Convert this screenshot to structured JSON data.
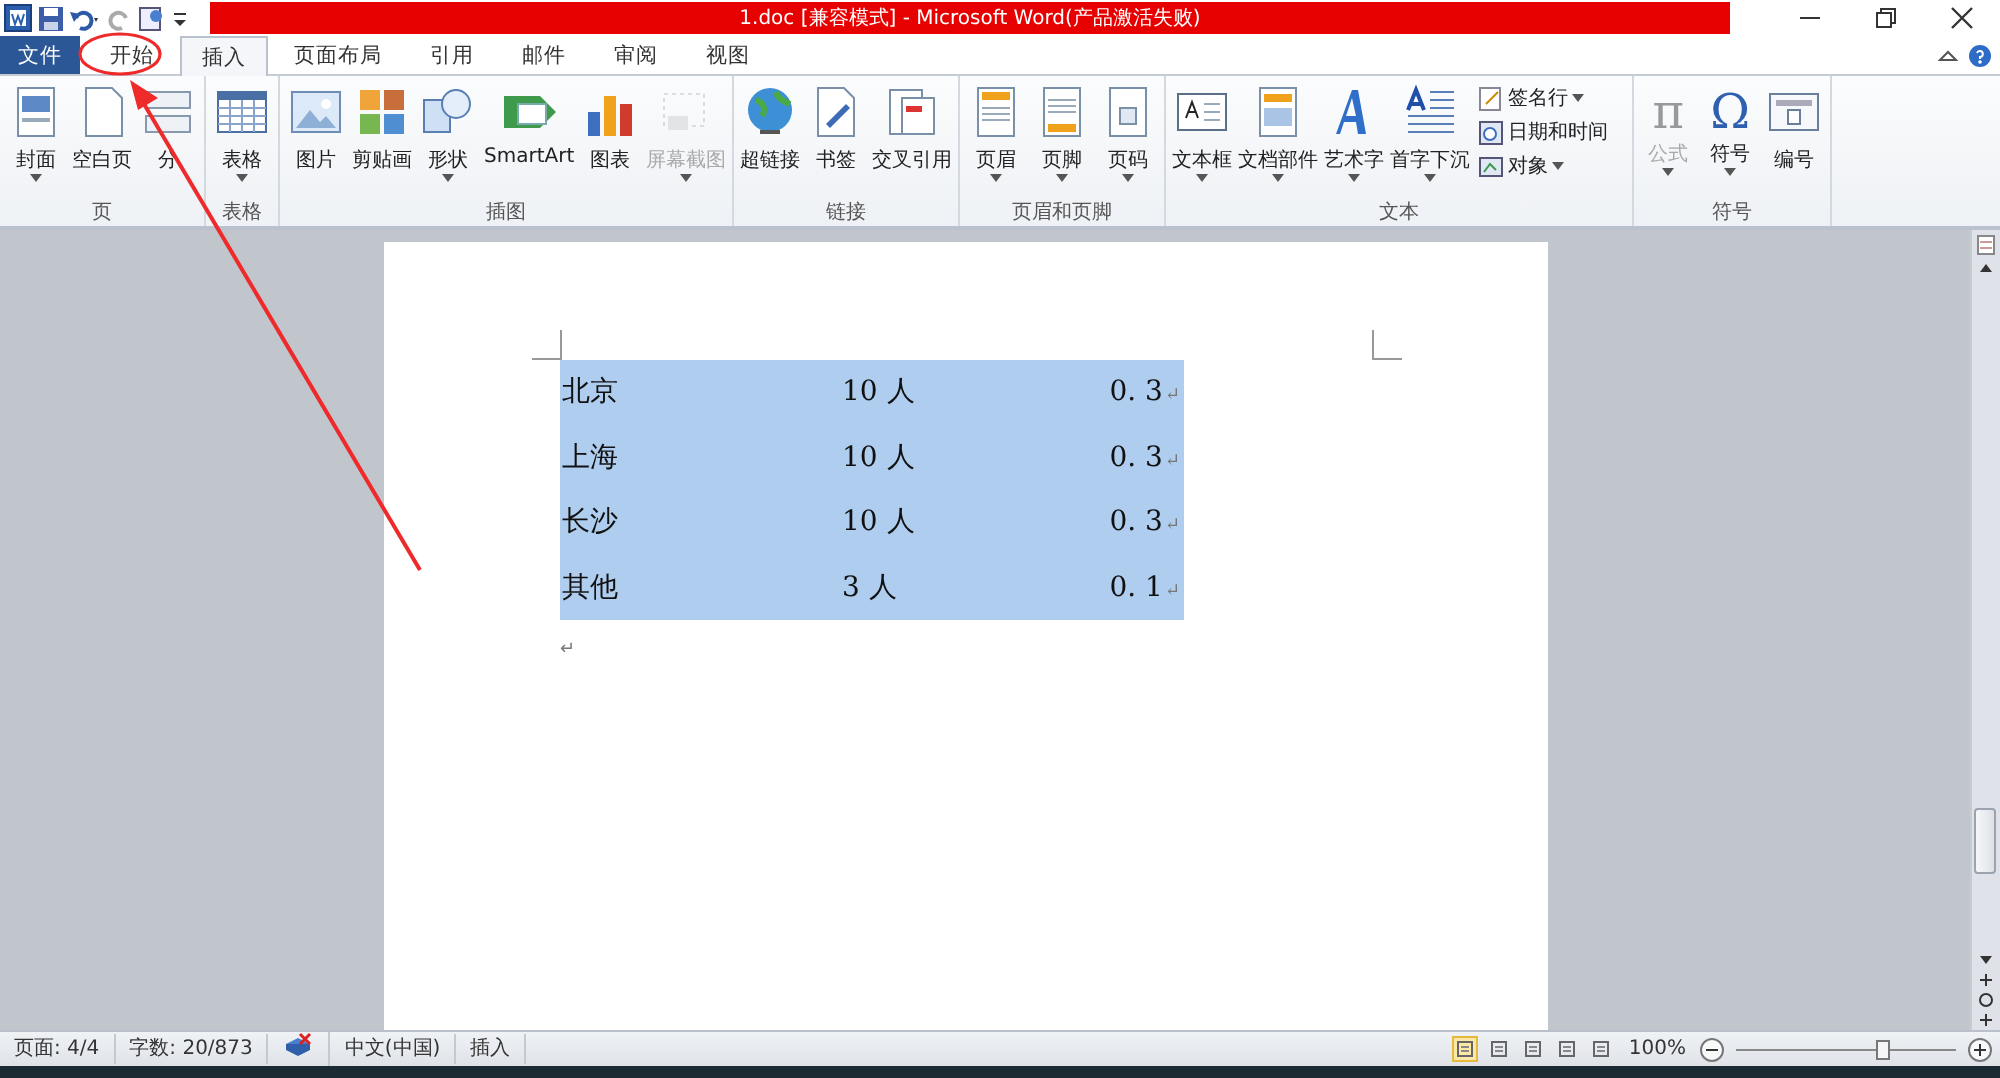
{
  "title_bar": {
    "title": "1.doc [兼容模式] - Microsoft Word(产品激活失败)"
  },
  "tabs": [
    {
      "label": "文件",
      "kind": "file",
      "selected": false
    },
    {
      "label": "开始",
      "kind": "tab",
      "selected": false
    },
    {
      "label": "插入",
      "kind": "tab",
      "selected": true
    },
    {
      "label": "页面布局",
      "kind": "tab",
      "selected": false
    },
    {
      "label": "引用",
      "kind": "tab",
      "selected": false
    },
    {
      "label": "邮件",
      "kind": "tab",
      "selected": false
    },
    {
      "label": "审阅",
      "kind": "tab",
      "selected": false
    },
    {
      "label": "视图",
      "kind": "tab",
      "selected": false
    }
  ],
  "ribbon": {
    "groups": [
      {
        "label": "页",
        "items": [
          {
            "label": "封面",
            "kind": "big",
            "dropdown": true,
            "disabled": false
          },
          {
            "label": "空白页",
            "kind": "big",
            "dropdown": false,
            "disabled": false
          },
          {
            "label": "分",
            "kind": "big",
            "dropdown": false,
            "disabled": false
          }
        ]
      },
      {
        "label": "表格",
        "items": [
          {
            "label": "表格",
            "kind": "big",
            "dropdown": true,
            "disabled": false
          }
        ]
      },
      {
        "label": "插图",
        "items": [
          {
            "label": "图片",
            "kind": "big",
            "dropdown": false,
            "disabled": false
          },
          {
            "label": "剪贴画",
            "kind": "big",
            "dropdown": false,
            "disabled": false
          },
          {
            "label": "形状",
            "kind": "big",
            "dropdown": true,
            "disabled": false
          },
          {
            "label": "SmartArt",
            "kind": "big",
            "dropdown": false,
            "disabled": false
          },
          {
            "label": "图表",
            "kind": "big",
            "dropdown": false,
            "disabled": false
          },
          {
            "label": "屏幕截图",
            "kind": "big",
            "dropdown": true,
            "disabled": true
          }
        ]
      },
      {
        "label": "链接",
        "items": [
          {
            "label": "超链接",
            "kind": "big",
            "dropdown": false,
            "disabled": false
          },
          {
            "label": "书签",
            "kind": "big",
            "dropdown": false,
            "disabled": false
          },
          {
            "label": "交叉引用",
            "kind": "big",
            "dropdown": false,
            "disabled": false
          }
        ]
      },
      {
        "label": "页眉和页脚",
        "items": [
          {
            "label": "页眉",
            "kind": "big",
            "dropdown": true,
            "disabled": false
          },
          {
            "label": "页脚",
            "kind": "big",
            "dropdown": true,
            "disabled": false
          },
          {
            "label": "页码",
            "kind": "big",
            "dropdown": true,
            "disabled": false
          }
        ]
      },
      {
        "label": "文本",
        "items": [
          {
            "label": "文本框",
            "kind": "big",
            "dropdown": true,
            "disabled": false
          },
          {
            "label": "文档部件",
            "kind": "big",
            "dropdown": true,
            "disabled": false
          },
          {
            "label": "艺术字",
            "kind": "big",
            "dropdown": true,
            "disabled": false
          },
          {
            "label": "首字下沉",
            "kind": "big",
            "dropdown": true,
            "disabled": false
          },
          {
            "label": "签名行",
            "kind": "small",
            "dropdown": true,
            "disabled": false
          },
          {
            "label": "日期和时间",
            "kind": "small",
            "dropdown": false,
            "disabled": false
          },
          {
            "label": "对象",
            "kind": "small",
            "dropdown": true,
            "disabled": false
          }
        ]
      },
      {
        "label": "符号",
        "items": [
          {
            "label": "公式",
            "kind": "glyph",
            "glyph": "π",
            "dropdown": true,
            "disabled": true
          },
          {
            "label": "符号",
            "kind": "glyph",
            "glyph": "Ω",
            "dropdown": true,
            "disabled": false
          },
          {
            "label": "编号",
            "kind": "big",
            "dropdown": false,
            "disabled": false
          }
        ]
      }
    ]
  },
  "document": {
    "table": {
      "rows": [
        {
          "city": "北京",
          "count": "10 人",
          "ratio": "0. 3",
          "mark": "↵"
        },
        {
          "city": "上海",
          "count": "10 人",
          "ratio": "0. 3",
          "mark": "↵"
        },
        {
          "city": "长沙",
          "count": "10 人",
          "ratio": "0. 3",
          "mark": "↵"
        },
        {
          "city": "其他",
          "count": "3 人",
          "ratio": "0. 1",
          "mark": "↵"
        }
      ],
      "selected": true
    },
    "paragraph_mark": "↵"
  },
  "status_bar": {
    "page": "页面: 4/4",
    "words": "字数: 20/873",
    "language": "中文(中国)",
    "mode": "插入",
    "views": [
      {
        "selected": true
      },
      {
        "selected": false
      },
      {
        "selected": false
      },
      {
        "selected": false
      },
      {
        "selected": false
      }
    ],
    "zoom": "100%",
    "zoom_slider": {
      "level": 0.66
    }
  },
  "annotations": {
    "highlight_circle": true,
    "pointer_arrow": true
  }
}
